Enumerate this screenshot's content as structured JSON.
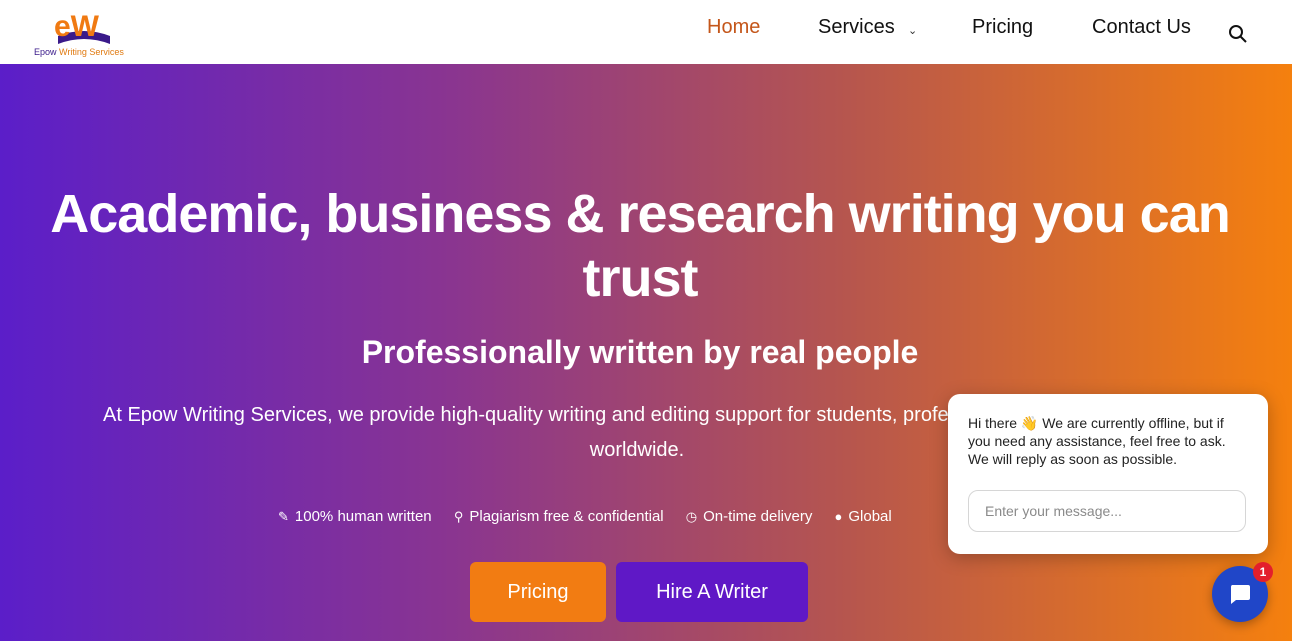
{
  "header": {
    "logo_mark": "eW",
    "logo_name_1": "Epow ",
    "logo_name_2": "Writing Services",
    "nav": {
      "home": "Home",
      "services": "Services",
      "pricing": "Pricing",
      "contact": "Contact Us"
    },
    "search_icon": "search-icon",
    "dropdown_icon": "chevron-down-icon"
  },
  "hero": {
    "title": "Academic, business & research writing you can trust",
    "subtitle": "Professionally written by real people",
    "description": "At Epow Writing Services, we provide high-quality writing and editing support for students, professionals, and businesses worldwide.",
    "features": [
      {
        "icon": "pen-icon",
        "label": "100% human written"
      },
      {
        "icon": "magnifier-icon",
        "label": "Plagiarism free & confidential"
      },
      {
        "icon": "clock-icon",
        "label": "On-time delivery"
      },
      {
        "icon": "globe-icon",
        "label": "Global"
      }
    ],
    "buttons": {
      "pricing": "Pricing",
      "hire": "Hire A Writer"
    }
  },
  "chat": {
    "greeting": "Hi there 👋 We are currently offline, but if you need any assistance, feel free to ask. We will reply as soon as possible.",
    "input_placeholder": "Enter your message...",
    "badge_count": "1",
    "launcher_icon": "chat-bubble-icon"
  },
  "colors": {
    "accent_orange": "#f27c12",
    "accent_purple": "#5f18c6",
    "nav_active": "#c4561a",
    "chat_blue": "#2046c8"
  }
}
